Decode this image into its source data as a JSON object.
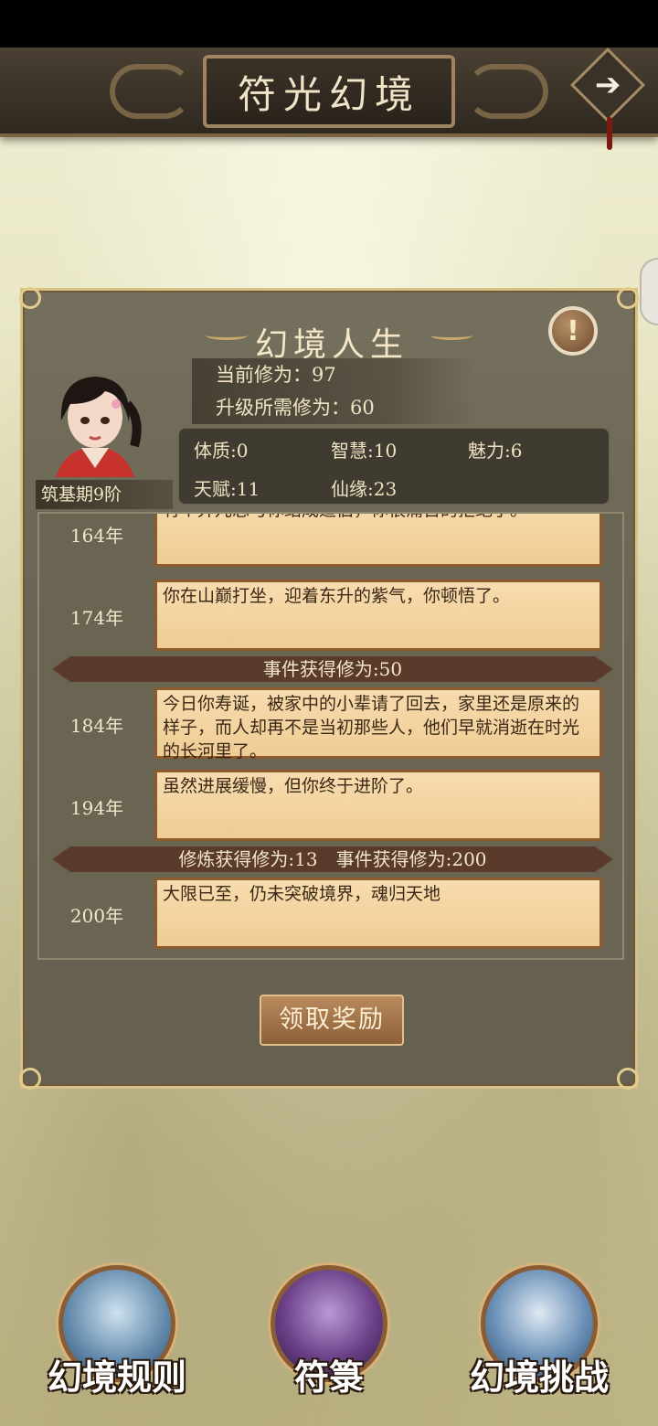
{
  "header": {
    "title": "符光幻境",
    "next_icon": "arrow-right-icon"
  },
  "panel": {
    "title": "幻境人生",
    "help_icon": "!",
    "current_cultivation": "当前修为：97",
    "required_cultivation": "升级所需修为：60",
    "realm": "筑基期9阶",
    "attributes": {
      "physique": "体质:0",
      "wisdom": "智慧:10",
      "charm": "魅力:6",
      "talent": "天赋:11",
      "fate": "仙缘:23"
    },
    "log": {
      "e0_year": "164年",
      "e0_text": "有个弃儿总与你结成道侣，你很痛苦的拒绝了。",
      "e1_year": "174年",
      "e1_text": "你在山巅打坐，迎着东升的紫气，你顿悟了。",
      "ribbon1": "事件获得修为:50",
      "e2_year": "184年",
      "e2_text": "今日你寿诞，被家中的小辈请了回去，家里还是原来的样子，而人却再不是当初那些人，他们早就消逝在时光的长河里了。",
      "e3_year": "194年",
      "e3_text": "虽然进展缓慢，但你终于进阶了。",
      "ribbon2": "修炼获得修为:13　事件获得修为:200",
      "e4_year": "200年",
      "e4_text": "大限已至，仍未突破境界，魂归天地"
    },
    "claim_button": "领取奖励"
  },
  "bottom": {
    "rules": "幻境规则",
    "talisman": "符箓",
    "challenge": "幻境挑战"
  }
}
